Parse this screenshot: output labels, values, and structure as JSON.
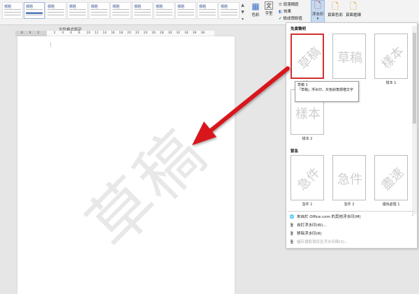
{
  "ribbon": {
    "style_tiles": [
      {
        "label": "標題"
      },
      {
        "label": "標題",
        "accent": true
      },
      {
        "label": "標題"
      },
      {
        "label": "標題"
      },
      {
        "label": "標題"
      },
      {
        "label": "標題"
      },
      {
        "label": "標題"
      },
      {
        "label": "標題"
      },
      {
        "label": "標題"
      },
      {
        "label": "標題"
      },
      {
        "label": "標題"
      }
    ],
    "group_label": "文件格式設定",
    "colors_label": "色彩",
    "fonts_label": "字型",
    "paragraph_spacing_label": "段落間距",
    "effects_label": "效果",
    "set_default_label": "設成預設值",
    "watermark_label": "浮水印",
    "page_color_label": "頁面色彩",
    "page_borders_label": "頁面框線"
  },
  "ruler": {
    "ticks": [
      "8",
      "4",
      "2",
      "",
      "2",
      "4",
      "6",
      "8",
      "10",
      "12",
      "14",
      "16",
      "18",
      "20",
      "22",
      "24",
      "26",
      "28",
      "30",
      "32",
      "34",
      "36",
      "38"
    ]
  },
  "document": {
    "watermark_text": "草稿"
  },
  "gallery": {
    "section_disclaimers": "免責聲明",
    "section_urgent": "緊急",
    "disclaimers": [
      {
        "text": "草稿",
        "diag": true,
        "caption": "草稿 1"
      },
      {
        "text": "草稿",
        "diag": false,
        "caption": ""
      },
      {
        "text": "樣本",
        "diag": true,
        "caption": "樣本 1"
      },
      {
        "text": "樣本",
        "diag": false,
        "caption": "樣本 2"
      }
    ],
    "urgent": [
      {
        "text": "急件",
        "diag": true,
        "caption": "急件 1"
      },
      {
        "text": "急件",
        "diag": false,
        "caption": "急件 2"
      },
      {
        "text": "盡速",
        "diag": true,
        "caption": "儘快處理 1"
      }
    ],
    "tooltip_title": "草稿 1",
    "tooltip_body": "「草稿」浮水印，灰色斜角標楷文字"
  },
  "menu": {
    "items": [
      {
        "label": "來自於 Office.com 的其他浮水印(M)",
        "icon": "🌐",
        "disabled": false,
        "sub": "›"
      },
      {
        "label": "自訂浮水印(W)...",
        "icon": "🖹",
        "disabled": false,
        "sub": ""
      },
      {
        "label": "移除浮水印(R)",
        "icon": "🖹",
        "disabled": false,
        "sub": ""
      },
      {
        "label": "儲存選取項目至浮水印庫(S)...",
        "icon": "🖹",
        "disabled": true,
        "sub": ""
      }
    ]
  }
}
